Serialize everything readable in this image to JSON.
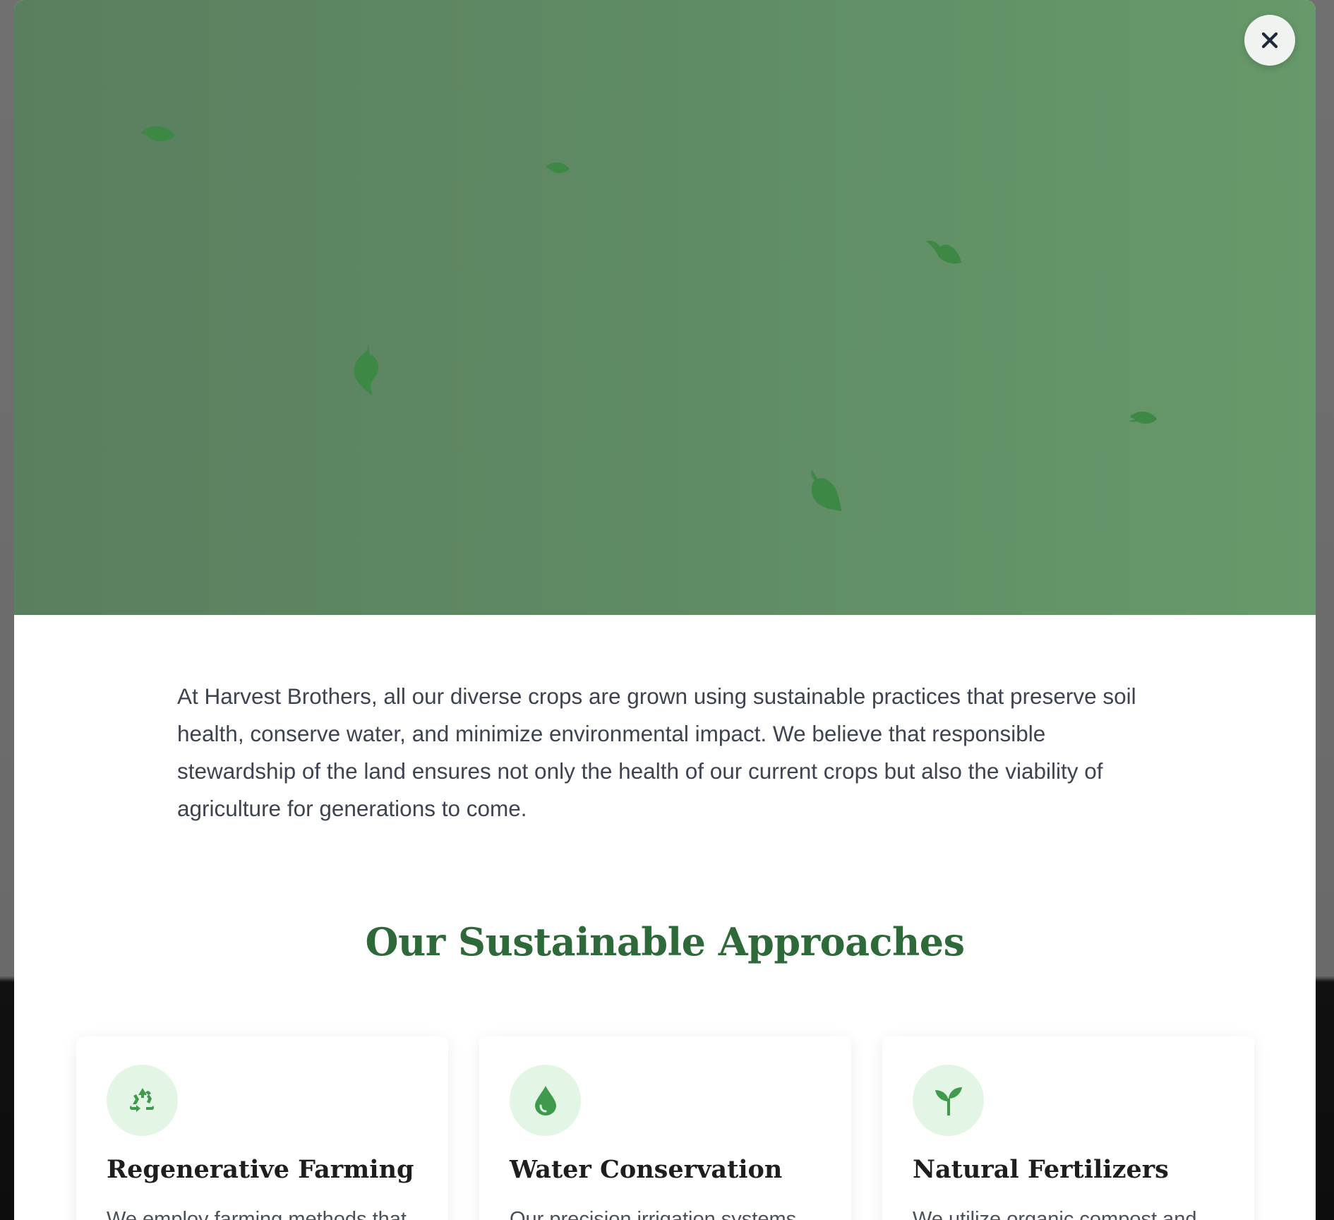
{
  "modal": {
    "close_icon": "close-icon"
  },
  "hero": {
    "background_color": "#5f8b64",
    "leaf_color": "#3e8846",
    "leaf_icon": "leaf-icon"
  },
  "intro": {
    "text": "At Harvest Brothers, all our diverse crops are grown using sustainable practices that preserve soil health, conserve water, and minimize environmental impact. We believe that responsible stewardship of the land ensures not only the health of our current crops but also the viability of agriculture for generations to come."
  },
  "section": {
    "title": "Our Sustainable Approaches",
    "accent_color": "#2e6a39"
  },
  "cards": [
    {
      "icon": "recycle-icon",
      "title": "Regenerative Farming",
      "text": "We employ farming methods that"
    },
    {
      "icon": "water-drop-icon",
      "title": "Water Conservation",
      "text": "Our precision irrigation systems"
    },
    {
      "icon": "seedling-icon",
      "title": "Natural Fertilizers",
      "text": "We utilize organic compost and"
    }
  ]
}
